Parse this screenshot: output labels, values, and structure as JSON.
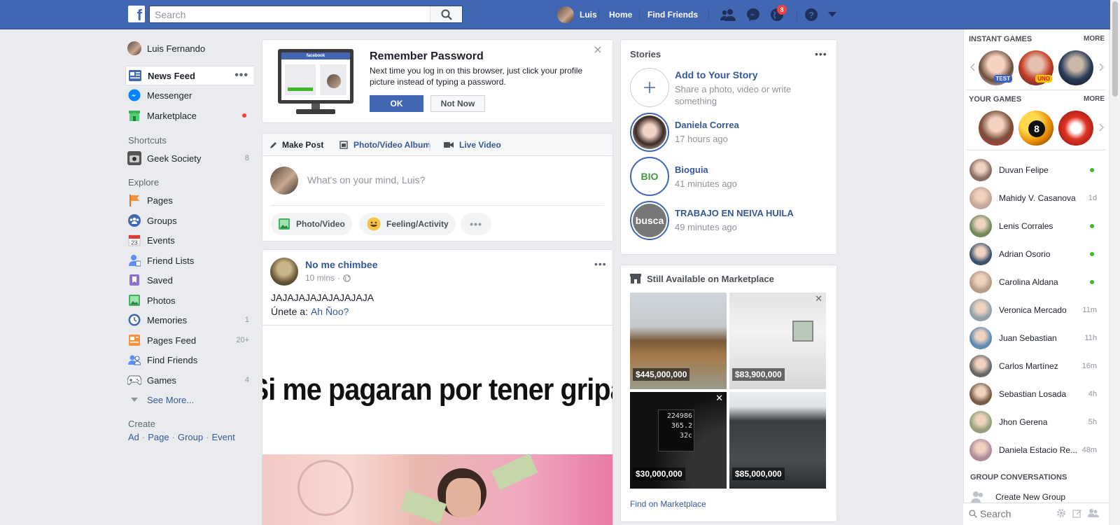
{
  "topbar": {
    "search_placeholder": "Search",
    "user_name": "Luis",
    "home": "Home",
    "find_friends": "Find Friends",
    "notif_count": "8",
    "brand_color": "#4267b2"
  },
  "left_nav": {
    "profile_name": "Luis Fernando",
    "main": [
      {
        "label": "News Feed",
        "icon": "news-feed-icon"
      },
      {
        "label": "Messenger",
        "icon": "messenger-icon"
      },
      {
        "label": "Marketplace",
        "icon": "marketplace-icon"
      }
    ],
    "shortcuts_title": "Shortcuts",
    "shortcuts": [
      {
        "label": "Geek Society",
        "count": "8",
        "icon": "group-photo-icon"
      }
    ],
    "explore_title": "Explore",
    "explore": [
      {
        "label": "Pages",
        "count": "",
        "icon": "flag-icon"
      },
      {
        "label": "Groups",
        "count": "",
        "icon": "groups-icon"
      },
      {
        "label": "Events",
        "count": "",
        "icon": "calendar-icon"
      },
      {
        "label": "Friend Lists",
        "count": "",
        "icon": "friend-list-icon"
      },
      {
        "label": "Saved",
        "count": "",
        "icon": "bookmark-icon"
      },
      {
        "label": "Photos",
        "count": "",
        "icon": "photos-icon"
      },
      {
        "label": "Memories",
        "count": "1",
        "icon": "clock-icon"
      },
      {
        "label": "Pages Feed",
        "count": "20+",
        "icon": "pages-feed-icon"
      },
      {
        "label": "Find Friends",
        "count": "",
        "icon": "find-friends-icon"
      },
      {
        "label": "Games",
        "count": "4",
        "icon": "gamepad-icon"
      }
    ],
    "see_more": "See More...",
    "create_title": "Create",
    "create_links": [
      "Ad",
      "Page",
      "Group",
      "Event"
    ],
    "create_sep": "·"
  },
  "remember": {
    "title": "Remember Password",
    "body": "Next time you log in on this browser, just click your profile picture instead of typing a password.",
    "ok": "OK",
    "not_now": "Not Now",
    "monitor_brand": "facebook"
  },
  "composer": {
    "tabs": [
      "Make Post",
      "Photo/Video Album",
      "Live Video"
    ],
    "placeholder": "What's on your mind, Luis?",
    "actions": [
      "Photo/Video",
      "Feeling/Activity"
    ]
  },
  "post": {
    "author": "No me chimbee",
    "time": "10 mins",
    "meta_sep": "·",
    "text1": "JAJAJAJAJAJAJAJAJA",
    "text2_prefix": "Únete a:",
    "text2_link": "Ah Ñoo?",
    "meme_text": "Si me pagaran por tener gripa"
  },
  "stories": {
    "title": "Stories",
    "add_title": "Add to Your Story",
    "add_sub": "Share a photo, video or write something",
    "items": [
      {
        "name": "Daniela Correa",
        "time": "17 hours ago",
        "ring_text": ""
      },
      {
        "name": "Bioguia",
        "time": "41 minutes ago",
        "ring_text": "BIO"
      },
      {
        "name": "TRABAJO EN NEIVA HUILA",
        "time": "49 minutes ago",
        "ring_text": "busca"
      }
    ]
  },
  "marketplace": {
    "title": "Still Available on Marketplace",
    "tiles": [
      {
        "price": "$445,000,000"
      },
      {
        "price": "$83,900,000"
      },
      {
        "price": "$30,000,000",
        "speedo": "224986",
        "speedo2": "365.2",
        "speedo3": "32c"
      },
      {
        "price": "$85,000,000"
      }
    ],
    "find_link": "Find on Marketplace"
  },
  "chat": {
    "instant_games": "INSTANT GAMES",
    "your_games": "YOUR GAMES",
    "more": "MORE",
    "game_badges": [
      "TEST",
      "UNO",
      "8"
    ],
    "contacts": [
      {
        "name": "Duvan Felipe",
        "status": "online"
      },
      {
        "name": "Mahidy V. Casanova",
        "status": "1d"
      },
      {
        "name": "Lenis Corrales",
        "status": "online"
      },
      {
        "name": "Adrian Osorio",
        "status": "online"
      },
      {
        "name": "Carolina Aldana",
        "status": "online"
      },
      {
        "name": "Veronica Mercado",
        "status": "11m"
      },
      {
        "name": "Juan Sebastian",
        "status": "11h"
      },
      {
        "name": "Carlos Martínez",
        "status": "16m"
      },
      {
        "name": "Sebastian Losada",
        "status": "4h"
      },
      {
        "name": "Jhon Gerena",
        "status": "5h"
      },
      {
        "name": "Daniela Estacio Re...",
        "status": "48m"
      }
    ],
    "group_conversations": "GROUP CONVERSATIONS",
    "create_group": "Create New Group",
    "search_placeholder": "Search"
  }
}
